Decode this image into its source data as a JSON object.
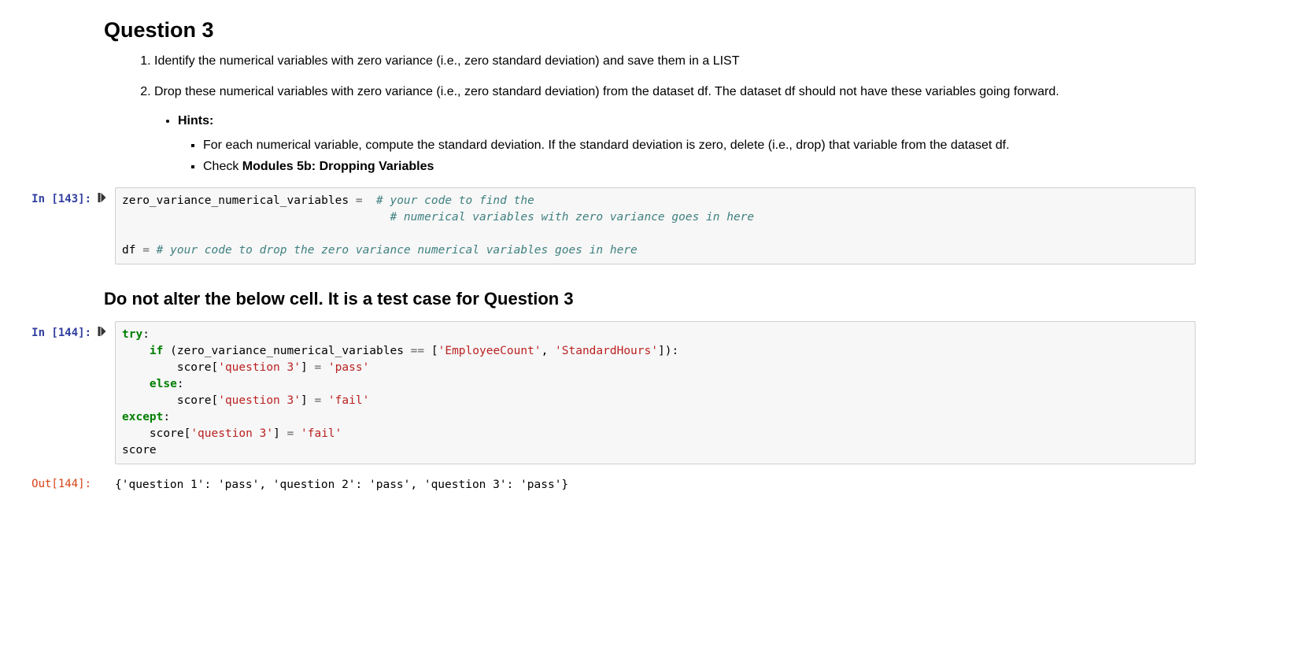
{
  "markdown1": {
    "title": "Question 3",
    "steps": [
      "Identify the numerical variables with zero variance (i.e., zero standard deviation) and save them in a LIST",
      "Drop these numerical variables with zero variance (i.e., zero standard deviation) from the dataset df. The dataset df should not have these variables going forward."
    ],
    "hints_label": "Hints:",
    "hints": {
      "h1": "For each numerical variable, compute the standard deviation. If the standard deviation is zero, delete (i.e., drop) that variable from the dataset df.",
      "h2a": "Check ",
      "h2b": "Modules 5b: Dropping Variables"
    }
  },
  "cell1": {
    "prompt": "In [143]:",
    "code": {
      "line1a": "zero_variance_numerical_variables ",
      "line1b": "=",
      "line1c": "  ",
      "line1_cm": "# your code to find the",
      "line2_pad": "                                       ",
      "line2_cm": "# numerical variables with zero variance goes in here",
      "blank": "",
      "line3a": "df ",
      "line3b": "=",
      "line3c": " ",
      "line3_cm": "# your code to drop the zero variance numerical variables goes in here"
    }
  },
  "markdown2": {
    "title": "Do not alter the below cell. It is a test case for Question 3"
  },
  "cell2": {
    "prompt": "In [144]:",
    "code": {
      "l1_kw": "try",
      "l1_colon": ":",
      "l2_pad": "    ",
      "l2_kw": "if",
      "l2_rest": " (zero_variance_numerical_variables ",
      "l2_eq": "==",
      "l2_sp": " [",
      "l2_s1": "'EmployeeCount'",
      "l2_comma": ", ",
      "l2_s2": "'StandardHours'",
      "l2_close": "]):",
      "l3_pad": "        score[",
      "l3_s1": "'question 3'",
      "l3_mid": "] ",
      "l3_eq": "=",
      "l3_sp": " ",
      "l3_s2": "'pass'",
      "l4_pad": "    ",
      "l4_kw": "else",
      "l4_colon": ":",
      "l5_pad": "        score[",
      "l5_s1": "'question 3'",
      "l5_mid": "] ",
      "l5_eq": "=",
      "l5_sp": " ",
      "l5_s2": "'fail'",
      "l6_kw": "except",
      "l6_colon": ":",
      "l7_pad": "    score[",
      "l7_s1": "'question 3'",
      "l7_mid": "] ",
      "l7_eq": "=",
      "l7_sp": " ",
      "l7_s2": "'fail'",
      "l8": "score"
    },
    "out_prompt": "Out[144]:",
    "output": "{'question 1': 'pass', 'question 2': 'pass', 'question 3': 'pass'}"
  }
}
